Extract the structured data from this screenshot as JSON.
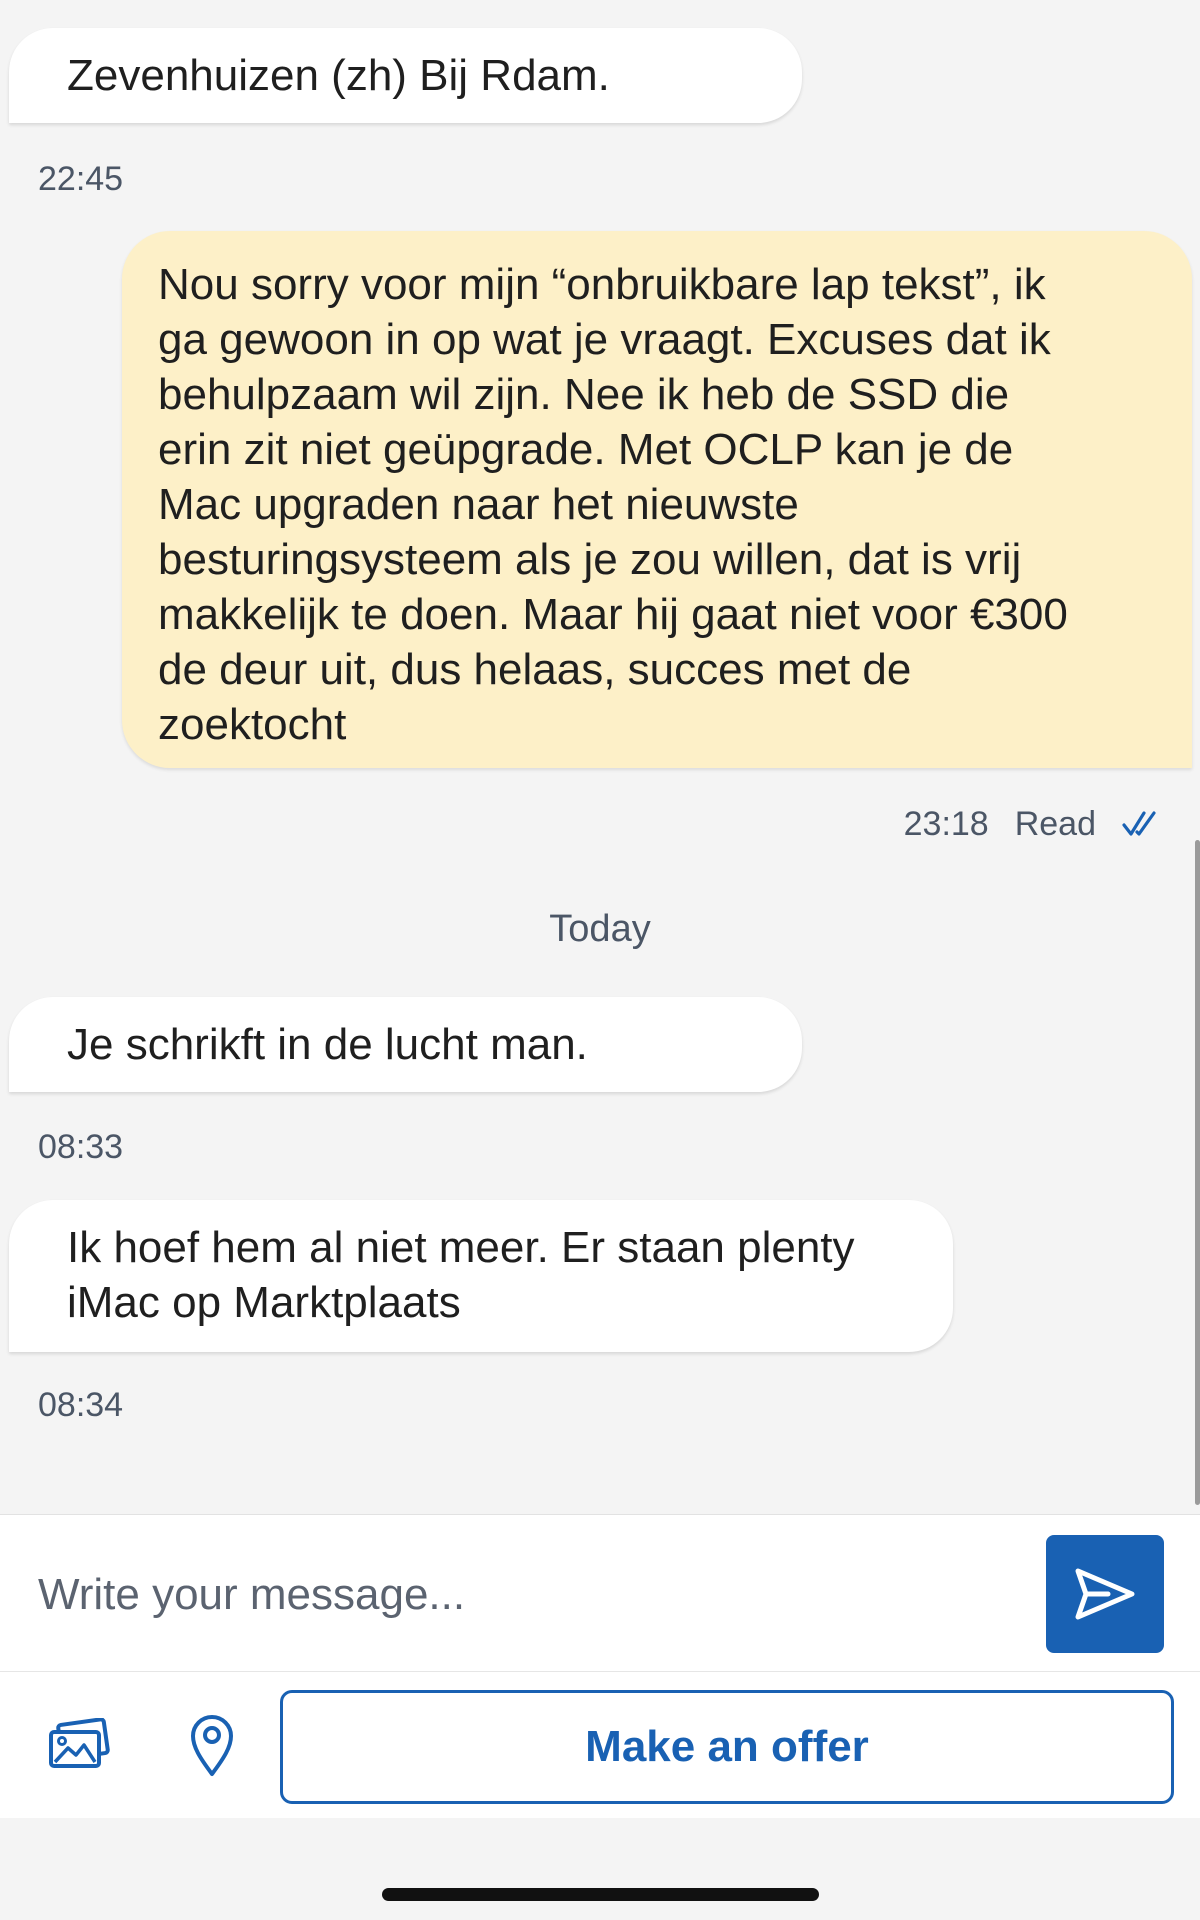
{
  "messages": [
    {
      "direction": "incoming",
      "text": "Zevenhuizen (zh) Bij Rdam.",
      "time": "22:45"
    },
    {
      "direction": "outgoing",
      "lines": [
        "Nou sorry voor mijn “onbruikbare lap tekst”, ik",
        "ga gewoon in op wat je vraagt. Excuses dat ik",
        "behulpzaam wil zijn. Nee ik heb de SSD die",
        "erin zit niet geüpgrade. Met OCLP kan je de",
        "Mac upgraden naar het nieuwste",
        "besturingsysteem als je zou willen, dat is vrij",
        "makkelijk te doen. Maar hij gaat niet voor €300",
        "de deur uit, dus helaas, succes met de",
        "zoektocht"
      ],
      "time": "23:18",
      "status": "Read"
    },
    {
      "direction": "incoming",
      "text": "Je schrikft in de lucht man.",
      "time": "08:33"
    },
    {
      "direction": "incoming",
      "lines": [
        "Ik hoef hem al niet meer. Er staan plenty",
        "iMac op Marktplaats"
      ],
      "time": "08:34"
    }
  ],
  "day_separator": "Today",
  "composer": {
    "placeholder": "Write your message..."
  },
  "toolbar": {
    "offer_label": "Make an offer"
  },
  "icons": {
    "send": "send-icon",
    "photo": "photo-gallery-icon",
    "location": "location-pin-icon",
    "read_receipt": "double-check-icon"
  },
  "colors": {
    "accent": "#1961b3",
    "outgoing_bubble": "#fdf0c8",
    "incoming_bubble": "#ffffff",
    "background": "#f4f4f4"
  }
}
